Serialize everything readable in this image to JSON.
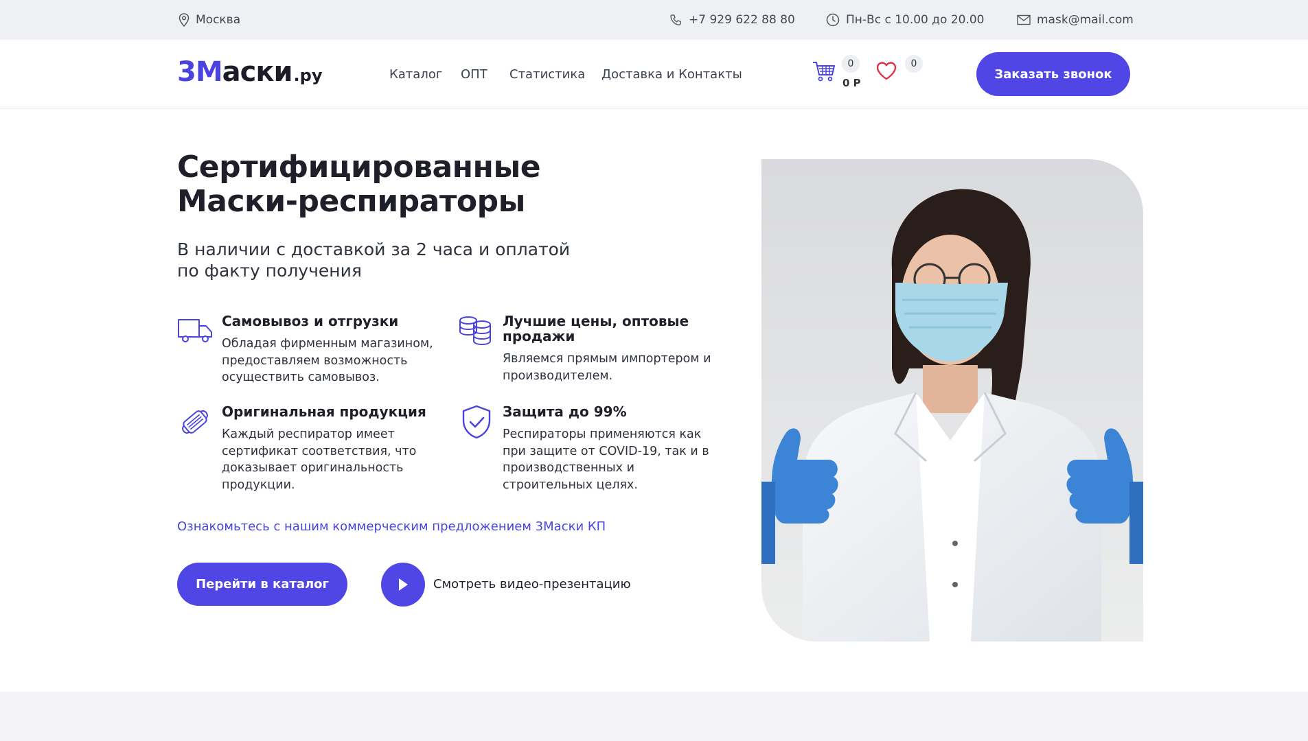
{
  "topbar": {
    "city": "Москва",
    "phone": "+7 929 622 88 80",
    "hours": "Пн-Вс с 10.00 до 20.00",
    "email": "mask@mail.com"
  },
  "header": {
    "logo": {
      "part1": "3М",
      "part2": "аски",
      "part3": ".ру"
    },
    "nav": [
      "Каталог",
      "ОПТ",
      "Статистика",
      "Доставка и Контакты"
    ],
    "cart_count": "0",
    "cart_sum": "0 Р",
    "favorites_count": "0",
    "callback_label": "Заказать звонок"
  },
  "hero": {
    "title_line1": "Сертифицированные",
    "title_line2": "Маски-респираторы",
    "subtitle": "В наличии с доставкой за 2 часа и оплатой по факту получения",
    "features": [
      {
        "icon": "truck-icon",
        "title": "Самовывоз и отгрузки",
        "text": "Обладая фирменным магазином, предоставляем возможность осуществить самовывоз."
      },
      {
        "icon": "coins-icon",
        "title": "Лучшие цены, оптовые продажи",
        "text": "Являемся прямым импортером и производителем."
      },
      {
        "icon": "mask-icon",
        "title": "Оригинальная продукция",
        "text": "Каждый респиратор имеет сертификат соответствия, что доказывает оригинальность продукции."
      },
      {
        "icon": "shield-check-icon",
        "title": "Защита до 99%",
        "text": "Респираторы применяются как при защите от COVID-19, так и в производственных и строительных целях."
      }
    ],
    "kp_link": "Ознакомьтесь с нашим коммерческим предложением 3Маски КП",
    "catalog_button": "Перейти в каталог",
    "video_label": "Смотреть видео-презентацию"
  },
  "colors": {
    "accent": "#5046e5",
    "topbar_bg": "#eef0f3",
    "text": "#1f1f2a"
  }
}
